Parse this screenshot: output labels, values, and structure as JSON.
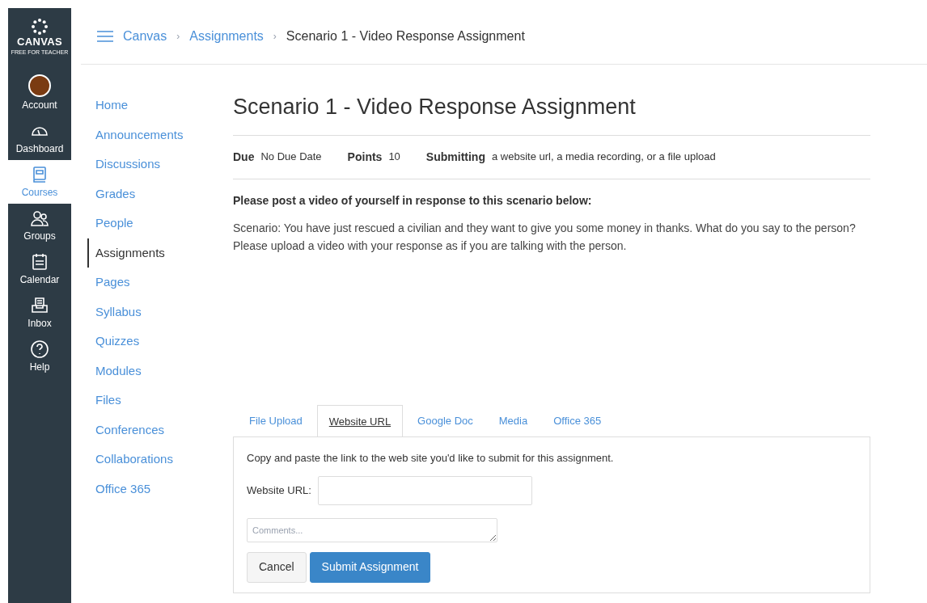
{
  "global_nav": {
    "logo": {
      "name": "CANVAS",
      "tagline": "FREE FOR TEACHER"
    },
    "items": [
      {
        "kind": "account",
        "label": "Account",
        "selected": false
      },
      {
        "kind": "dashboard",
        "label": "Dashboard",
        "selected": false
      },
      {
        "kind": "courses",
        "label": "Courses",
        "selected": true
      },
      {
        "kind": "groups",
        "label": "Groups",
        "selected": false
      },
      {
        "kind": "calendar",
        "label": "Calendar",
        "selected": false
      },
      {
        "kind": "inbox",
        "label": "Inbox",
        "selected": false
      },
      {
        "kind": "help",
        "label": "Help",
        "selected": false
      }
    ]
  },
  "breadcrumbs": [
    "Canvas",
    "Assignments",
    "Scenario 1 - Video Response Assignment"
  ],
  "breadcrumb_separator": "›",
  "course_nav": [
    {
      "label": "Home",
      "selected": false
    },
    {
      "label": "Announcements",
      "selected": false
    },
    {
      "label": "Discussions",
      "selected": false
    },
    {
      "label": "Grades",
      "selected": false
    },
    {
      "label": "People",
      "selected": false
    },
    {
      "label": "Assignments",
      "selected": true
    },
    {
      "label": "Pages",
      "selected": false
    },
    {
      "label": "Syllabus",
      "selected": false
    },
    {
      "label": "Quizzes",
      "selected": false
    },
    {
      "label": "Modules",
      "selected": false
    },
    {
      "label": "Files",
      "selected": false
    },
    {
      "label": "Conferences",
      "selected": false
    },
    {
      "label": "Collaborations",
      "selected": false
    },
    {
      "label": "Office 365",
      "selected": false
    }
  ],
  "assignment": {
    "title": "Scenario 1 - Video Response Assignment",
    "details": [
      {
        "label": "Due",
        "value": "No Due Date"
      },
      {
        "label": "Points",
        "value": "10"
      },
      {
        "label": "Submitting",
        "value": "a website url, a media recording, or a file upload"
      }
    ],
    "prompt": "Please post a video of yourself in response to this scenario below:",
    "scenario": "Scenario: You have just rescued a civilian and they want to give you some money in thanks. What do you say to the person? Please upload a video with your response as if you are talking with the person."
  },
  "submission": {
    "tabs": [
      {
        "label": "File Upload",
        "selected": false
      },
      {
        "label": "Website URL",
        "selected": true
      },
      {
        "label": "Google Doc",
        "selected": false
      },
      {
        "label": "Media",
        "selected": false
      },
      {
        "label": "Office 365",
        "selected": false
      }
    ],
    "instructions": "Copy and paste the link to the web site you'd like to submit for this assignment.",
    "url_label": "Website URL:",
    "comments_placeholder": "Comments...",
    "buttons": [
      {
        "kind": "secondary",
        "label": "Cancel"
      },
      {
        "kind": "primary",
        "label": "Submit Assignment"
      }
    ]
  }
}
